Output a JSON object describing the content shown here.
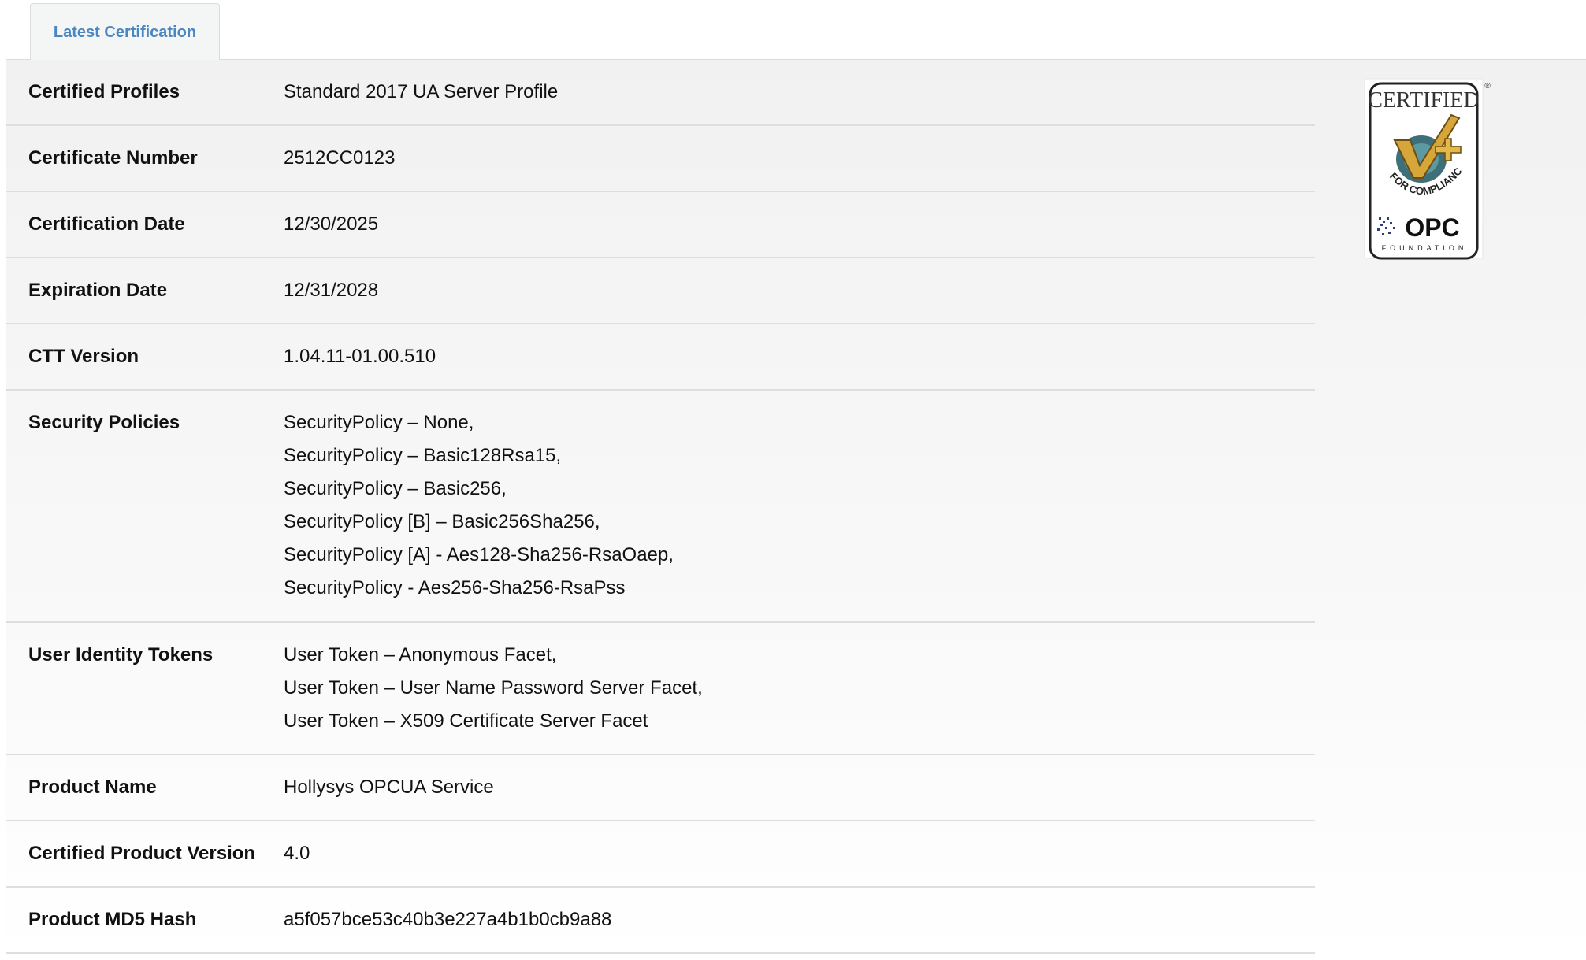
{
  "tabs": [
    {
      "label": "Latest Certification"
    }
  ],
  "rows": [
    {
      "label": "Certified Profiles",
      "values": [
        "Standard 2017 UA Server Profile"
      ]
    },
    {
      "label": "Certificate Number",
      "values": [
        "2512CC0123"
      ]
    },
    {
      "label": "Certification Date",
      "values": [
        "12/30/2025"
      ]
    },
    {
      "label": "Expiration Date",
      "values": [
        "12/31/2028"
      ]
    },
    {
      "label": "CTT Version",
      "values": [
        "1.04.11-01.00.510"
      ]
    },
    {
      "label": "Security Policies",
      "values": [
        "SecurityPolicy – None,",
        "SecurityPolicy – Basic128Rsa15,",
        "SecurityPolicy – Basic256,",
        "SecurityPolicy [B] – Basic256Sha256,",
        "SecurityPolicy [A] - Aes128-Sha256-RsaOaep,",
        "SecurityPolicy - Aes256-Sha256-RsaPss"
      ]
    },
    {
      "label": "User Identity Tokens",
      "values": [
        "User Token – Anonymous Facet,",
        "User Token – User Name Password Server Facet,",
        "User Token – X509 Certificate Server Facet"
      ]
    },
    {
      "label": "Product Name",
      "values": [
        "Hollysys OPCUA Service"
      ]
    },
    {
      "label": "Certified Product Version",
      "values": [
        "4.0"
      ]
    },
    {
      "label": "Product MD5 Hash",
      "values": [
        "a5f057bce53c40b3e227a4b1b0cb9a88"
      ]
    }
  ],
  "badge": {
    "top_text": "CERTIFIED",
    "arc_text": "FOR COMPLIANCE",
    "logo_text": "OPC",
    "foundation_text": "FOUNDATION",
    "registered": "®",
    "icon": "certified-checkmark-icon"
  }
}
